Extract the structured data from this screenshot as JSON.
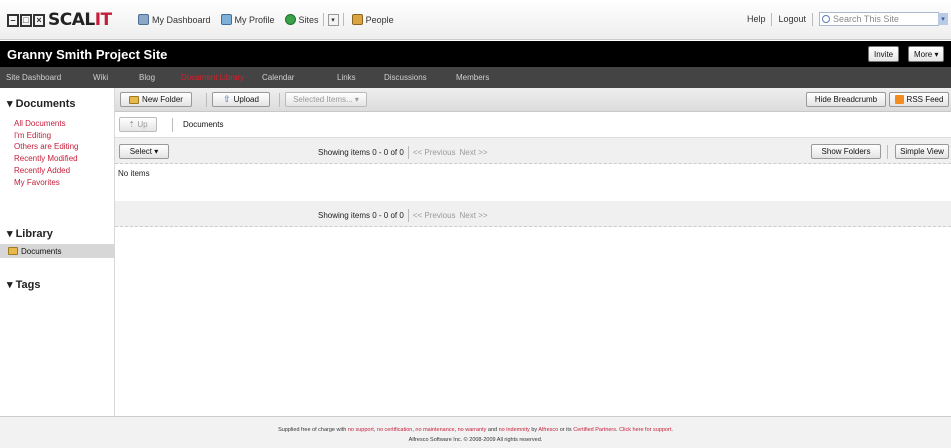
{
  "brand": {
    "boxes": [
      "–",
      "□",
      "×"
    ],
    "word_main": "SCAL",
    "word_accent": "IT",
    "accent": "#c41e3a"
  },
  "topnav": {
    "dashboard": "My Dashboard",
    "profile": "My Profile",
    "sites": "Sites",
    "people": "People"
  },
  "topright": {
    "help": "Help",
    "logout": "Logout",
    "search_placeholder": "Search This Site"
  },
  "site": {
    "title": "Granny Smith Project Site",
    "invite": "Invite",
    "more": "More ▾"
  },
  "sitenav": {
    "items": [
      "Site Dashboard",
      "Wiki",
      "Blog",
      "Document Library",
      "Calendar",
      "Links",
      "Discussions",
      "Members"
    ],
    "active_index": 3
  },
  "sidebar": {
    "documents_header": "▾ Documents",
    "documents_links": [
      "All Documents",
      "I'm Editing",
      "Others are Editing",
      "Recently Modified",
      "Recently Added",
      "My Favorites"
    ],
    "library_header": "▾ Library",
    "library_item": "Documents",
    "tags_header": "▾ Tags"
  },
  "toolbar": {
    "new_folder": "New Folder",
    "upload": "Upload",
    "selected_items": "Selected Items... ▾",
    "hide_breadcrumb": "Hide Breadcrumb",
    "rss_feed": "RSS Feed"
  },
  "breadcrumb": {
    "up": "⇡ Up",
    "current": "Documents"
  },
  "list": {
    "select": "Select ▾",
    "showing": "Showing items 0 - 0 of 0",
    "previous": "<< Previous",
    "next": "Next >>",
    "show_folders": "Show Folders",
    "simple_view": "Simple View",
    "empty": "No items"
  },
  "footer": {
    "prefix": "Supplied free of charge with ",
    "l_support": "no support",
    "l_cert": "no certification",
    "l_maint": "no maintenance",
    "l_warr": "no warranty",
    "and": " and ",
    "l_indem": "no indemnity",
    "by": " by ",
    "l_alfresco": "Alfresco",
    "or_its": " or its ",
    "l_partners": "Certified Partners",
    "l_click": "Click here for support",
    "copyright": "Alfresco Software Inc. © 2008-2009 All rights reserved."
  }
}
